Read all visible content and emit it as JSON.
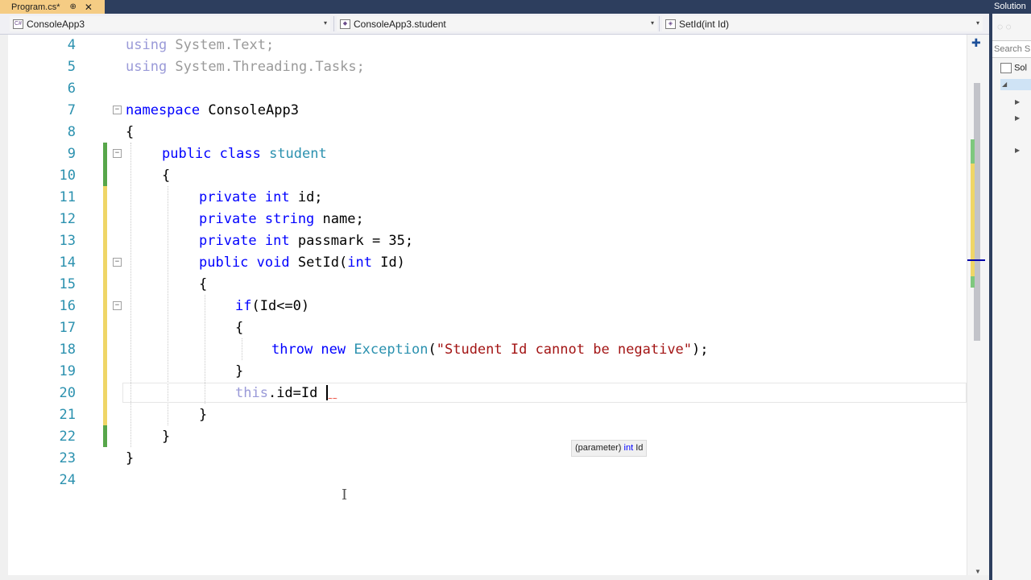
{
  "tab": {
    "title": "Program.cs*",
    "pin": "⊕",
    "close": "✕"
  },
  "navbar": {
    "project": "ConsoleApp3",
    "type": "ConsoleApp3.student",
    "member": "SetId(int Id)",
    "dropdown_arrow": "▾"
  },
  "lines": [
    {
      "n": "4"
    },
    {
      "n": "5"
    },
    {
      "n": "6"
    },
    {
      "n": "7"
    },
    {
      "n": "8"
    },
    {
      "n": "9"
    },
    {
      "n": "10"
    },
    {
      "n": "11"
    },
    {
      "n": "12"
    },
    {
      "n": "13"
    },
    {
      "n": "14"
    },
    {
      "n": "15"
    },
    {
      "n": "16"
    },
    {
      "n": "17"
    },
    {
      "n": "18"
    },
    {
      "n": "19"
    },
    {
      "n": "20"
    },
    {
      "n": "21"
    },
    {
      "n": "22"
    },
    {
      "n": "23"
    },
    {
      "n": "24"
    }
  ],
  "code": {
    "l4_using": "using",
    "l4_ns": " System.Text;",
    "l5_using": "using",
    "l5_ns": " System.Threading.Tasks;",
    "l7_kw": "namespace",
    "l7_name": " ConsoleApp3",
    "open_brace": "{",
    "close_brace": "}",
    "l9_kw": "public class",
    "l9_name": "student",
    "l11_kw": "private int",
    "l11_rest": " id;",
    "l12_kw": "private string",
    "l12_rest": " name;",
    "l13_kw": "private int",
    "l13_rest": " passmark = 35;",
    "l14_kw": "public void",
    "l14_m": " SetId(",
    "l14_kw2": "int",
    "l14_rest": " Id)",
    "l16_kw": "if",
    "l16_rest": "(Id<=0)",
    "l18_kw": "throw new",
    "l18_type": "Exception",
    "l18_p1": "(",
    "l18_str": "\"Student Id cannot be negative\"",
    "l18_p2": ");",
    "l20_this": "this",
    "l20_rest": ".id=Id"
  },
  "tooltip": {
    "prefix": "(parameter)",
    "type": "int",
    "name": "Id"
  },
  "folds": {
    "minus": "−"
  },
  "scrollbar": {
    "split_icon": "✚",
    "down_arrow": "▼"
  },
  "solution": {
    "title": "Solution",
    "tools": "◌  ◌",
    "search": "Search S",
    "root": "Sol",
    "expand": "▶",
    "collapse": "◢"
  },
  "ibeam": "I",
  "squiggle": "~~"
}
